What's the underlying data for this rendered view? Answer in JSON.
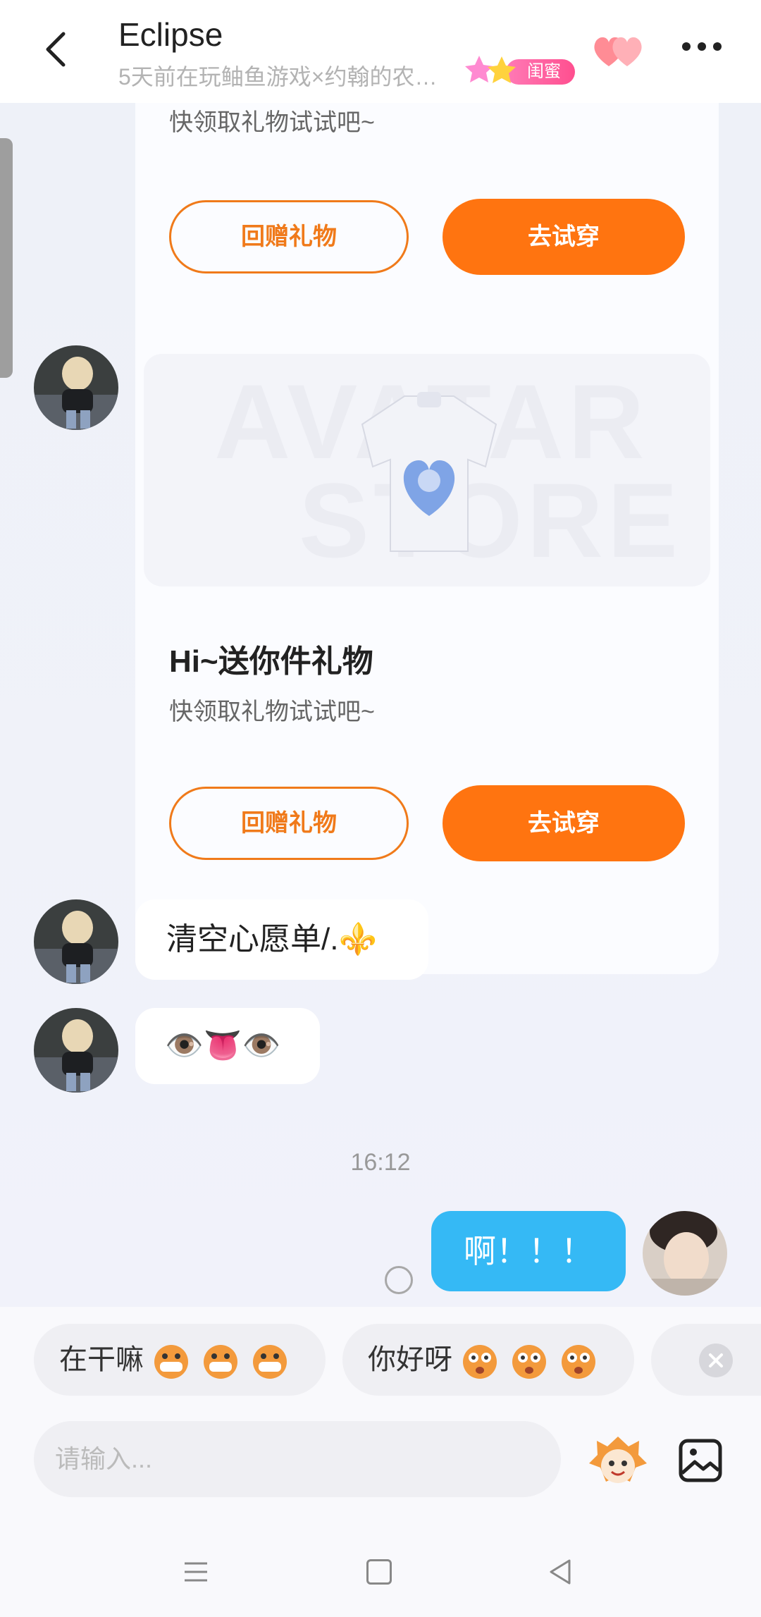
{
  "header": {
    "title": "Eclipse",
    "subtitle": "5天前在玩鲉鱼游戏×约翰的农…",
    "badge": "闺蜜"
  },
  "messages": {
    "gift1": {
      "subtitle": "快领取礼物试试吧~",
      "return_label": "回赠礼物",
      "try_label": "去试穿"
    },
    "gift2": {
      "watermark_line1": "AVATAR",
      "watermark_line2": "STORE",
      "title": "Hi~送你件礼物",
      "subtitle": "快领取礼物试试吧~",
      "return_label": "回赠礼物",
      "try_label": "去试穿"
    },
    "text1": "清空心愿单/.⚜️",
    "text2": "👁️👅👁️",
    "time": "16:12",
    "my_text": "啊！！！"
  },
  "quick_replies": [
    {
      "label": "在干嘛"
    },
    {
      "label": "你好呀"
    }
  ],
  "input": {
    "placeholder": "请输入..."
  },
  "colors": {
    "accent": "#ff7410",
    "my_bubble": "#35b9f5",
    "badge": "#ff4f8f"
  }
}
